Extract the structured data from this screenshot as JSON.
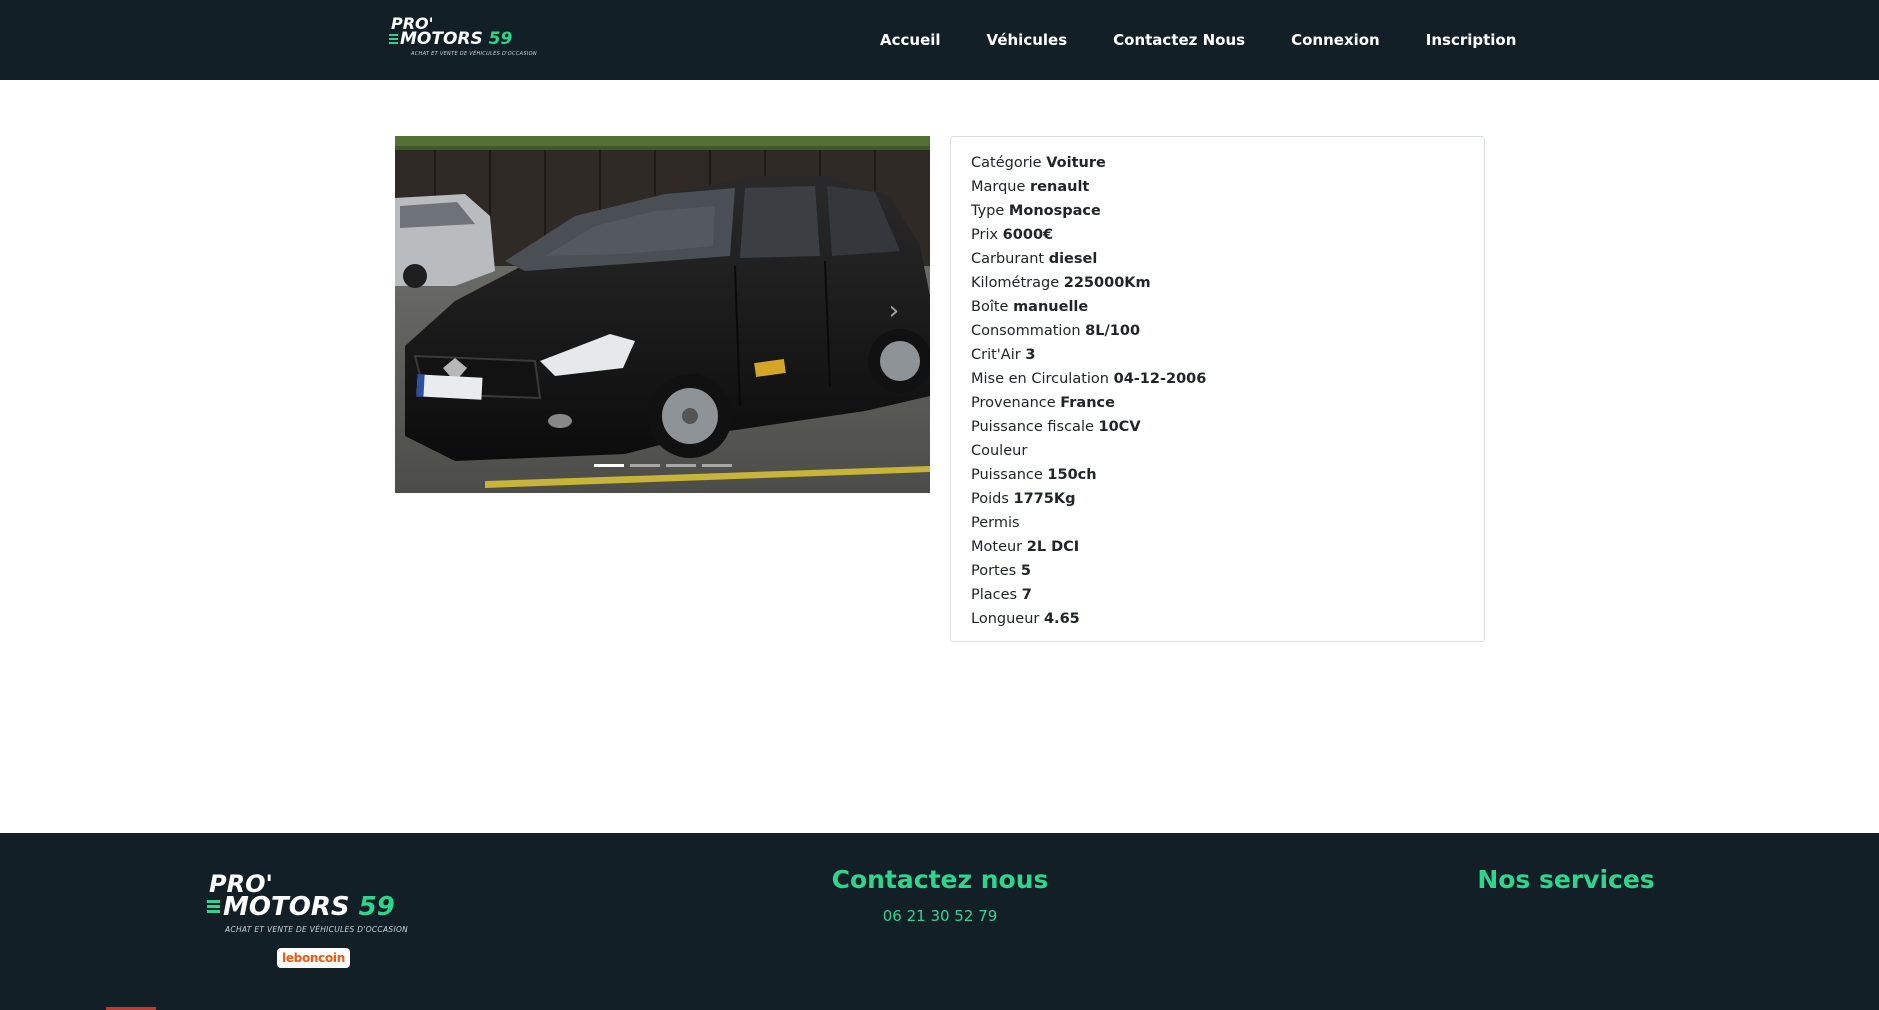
{
  "header": {
    "logo": {
      "line1": "PRO'",
      "line2_white": "MOTORS ",
      "line2_green": "59",
      "tagline": "ACHAT ET VENTE DE VÉHICULES D'OCCASION"
    },
    "nav": [
      {
        "label": "Accueil"
      },
      {
        "label": "Véhicules"
      },
      {
        "label": "Contactez Nous"
      },
      {
        "label": "Connexion"
      },
      {
        "label": "Inscription"
      }
    ]
  },
  "carousel": {
    "slides": 4,
    "active_slide": 1,
    "next_icon": "chevron-right-icon"
  },
  "specs": [
    {
      "label": "Catégorie",
      "value": "Voiture"
    },
    {
      "label": "Marque",
      "value": "renault"
    },
    {
      "label": "Type",
      "value": "Monospace"
    },
    {
      "label": "Prix",
      "value": "6000€"
    },
    {
      "label": "Carburant",
      "value": "diesel"
    },
    {
      "label": "Kilométrage",
      "value": "225000Km"
    },
    {
      "label": "Boîte",
      "value": "manuelle"
    },
    {
      "label": "Consommation",
      "value": "8L/100"
    },
    {
      "label": "Crit'Air",
      "value": "3"
    },
    {
      "label": "Mise en Circulation",
      "value": "04-12-2006"
    },
    {
      "label": "Provenance",
      "value": "France"
    },
    {
      "label": "Puissance fiscale",
      "value": "10CV"
    },
    {
      "label": "Couleur",
      "value": ""
    },
    {
      "label": "Puissance",
      "value": "150ch"
    },
    {
      "label": "Poids",
      "value": "1775Kg"
    },
    {
      "label": "Permis",
      "value": ""
    },
    {
      "label": "Moteur",
      "value": "2L DCI"
    },
    {
      "label": "Portes",
      "value": "5"
    },
    {
      "label": "Places",
      "value": "7"
    },
    {
      "label": "Longueur",
      "value": "4.65"
    }
  ],
  "footer": {
    "logo": {
      "line1": "PRO'",
      "line2_white": "MOTORS ",
      "line2_green": "59",
      "tagline": "ACHAT ET VENTE DE VÉHICULES D'OCCASION"
    },
    "partner_badge": "leboncoin",
    "contact_heading": "Contactez nous",
    "phone": "06 21 30 52 79",
    "services_heading": "Nos services"
  },
  "colors": {
    "navbar_bg": "#131f27",
    "accent_green": "#2ed68b",
    "leboncoin_orange": "#ec5a13"
  }
}
